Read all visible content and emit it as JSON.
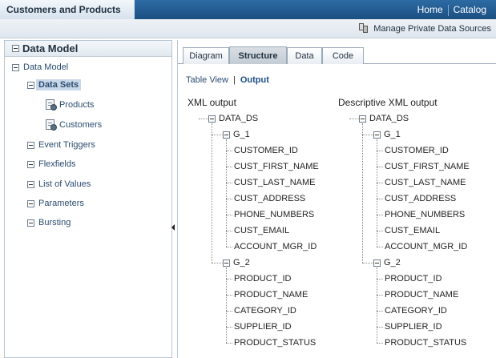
{
  "header": {
    "title": "Customers and Products",
    "nav": [
      "Home",
      "Catalog"
    ],
    "manage_label": "Manage Private Data Sources"
  },
  "left_panel": {
    "title": "Data Model",
    "tree": {
      "root": "Data Model",
      "data_sets": "Data Sets",
      "datasets": [
        "Products",
        "Customers"
      ],
      "others": [
        "Event Triggers",
        "Flexfields",
        "List of Values",
        "Parameters",
        "Bursting"
      ]
    }
  },
  "tabs": [
    {
      "label": "Diagram",
      "active": false
    },
    {
      "label": "Structure",
      "active": true
    },
    {
      "label": "Data",
      "active": false
    },
    {
      "label": "Code",
      "active": false
    }
  ],
  "view_links": {
    "table_view": "Table View",
    "separator": "|",
    "output": "Output"
  },
  "columns": [
    {
      "title": "XML output",
      "root": "DATA_DS",
      "group1": "G_1",
      "group1_fields": [
        "CUSTOMER_ID",
        "CUST_FIRST_NAME",
        "CUST_LAST_NAME",
        "CUST_ADDRESS",
        "PHONE_NUMBERS",
        "CUST_EMAIL",
        "ACCOUNT_MGR_ID"
      ],
      "group2": "G_2",
      "group2_fields": [
        "PRODUCT_ID",
        "PRODUCT_NAME",
        "CATEGORY_ID",
        "SUPPLIER_ID",
        "PRODUCT_STATUS"
      ]
    },
    {
      "title": "Descriptive XML output",
      "root": "DATA_DS",
      "group1": "G_1",
      "group1_fields": [
        "CUSTOMER_ID",
        "CUST_FIRST_NAME",
        "CUST_LAST_NAME",
        "CUST_ADDRESS",
        "PHONE_NUMBERS",
        "CUST_EMAIL",
        "ACCOUNT_MGR_ID"
      ],
      "group2": "G_2",
      "group2_fields": [
        "PRODUCT_ID",
        "PRODUCT_NAME",
        "CATEGORY_ID",
        "SUPPLIER_ID",
        "PRODUCT_STATUS"
      ]
    }
  ],
  "icons": {
    "collapse": "minus-box-icon",
    "data_set": "data-set-icon",
    "manage_sources": "data-sources-icon",
    "splitter": "collapse-left-arrow-icon"
  }
}
